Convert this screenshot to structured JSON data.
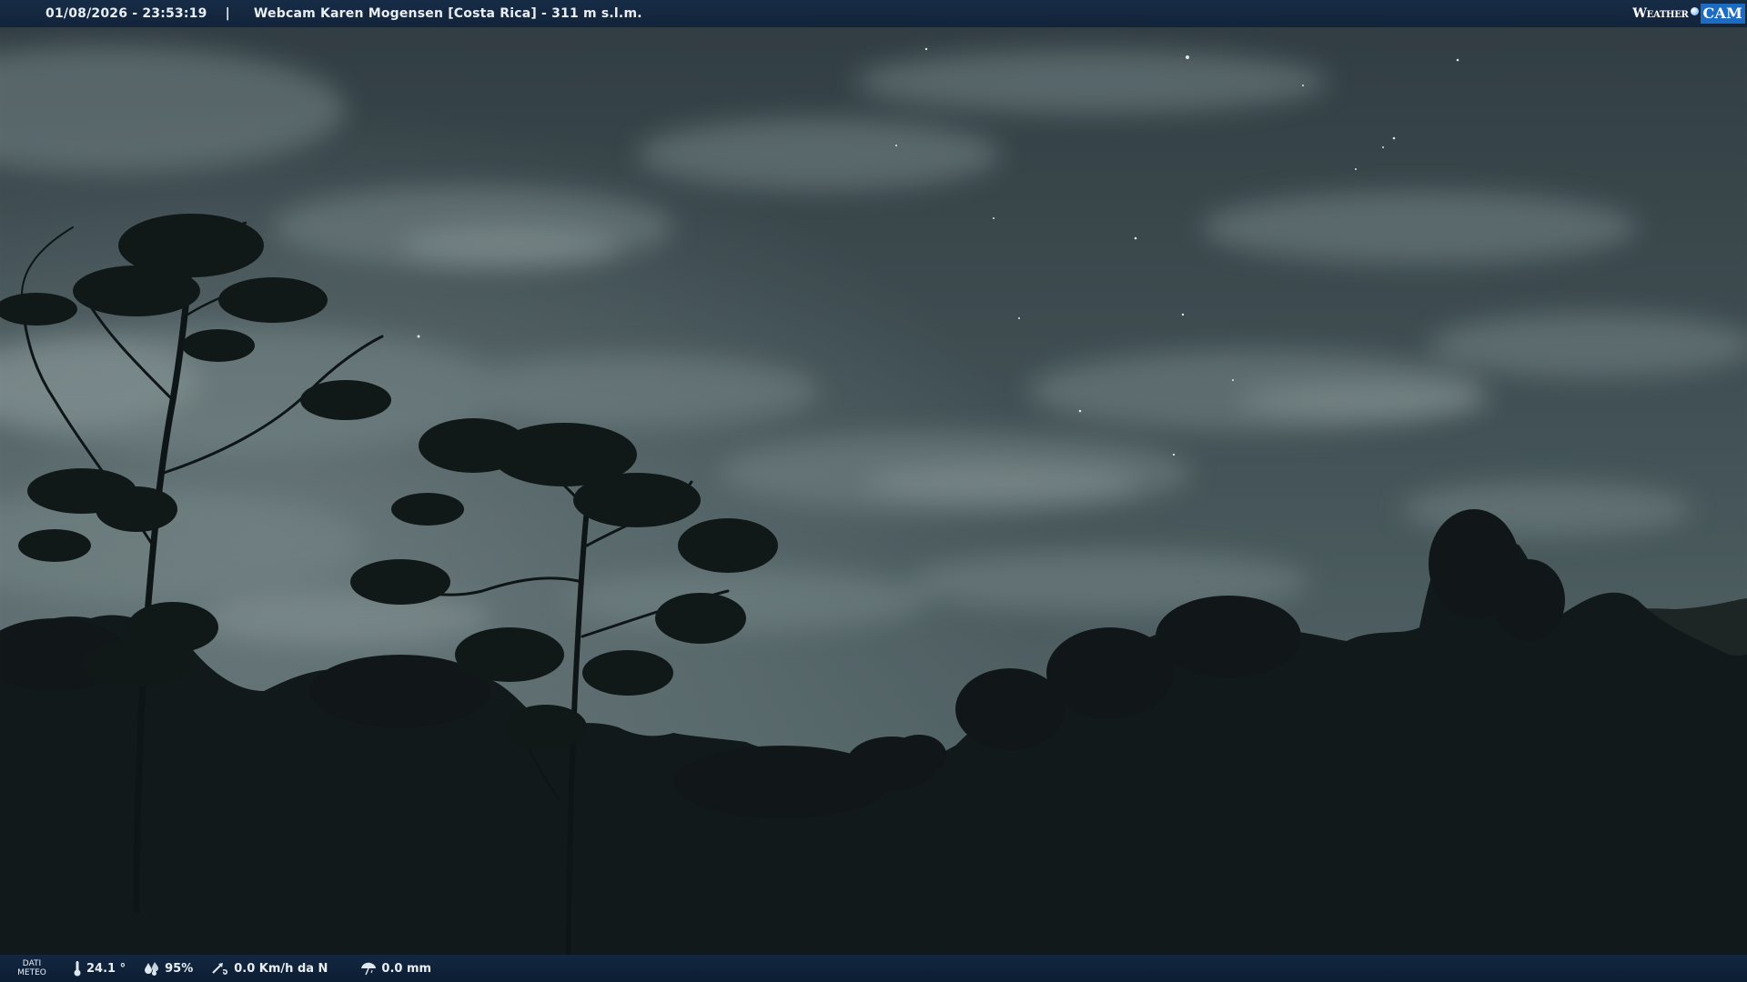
{
  "header": {
    "datetime": "01/08/2026 - 23:53:19",
    "separator": "|",
    "title": "Webcam Karen Mogensen [Costa Rica] - 311 m s.l.m.",
    "logo_weather": "Weather",
    "logo_cam": "CAM"
  },
  "footer": {
    "label_line1": "DATI",
    "label_line2": "METEO",
    "temperature": "24.1 °",
    "humidity": "95%",
    "wind": "0.0 Km/h da N",
    "rain": "0.0 mm"
  },
  "icons": {
    "temperature": "thermometer-icon",
    "humidity": "humidity-drops-icon",
    "wind": "wind-icon",
    "rain": "rain-umbrella-icon"
  },
  "colors": {
    "bar_background": "#13294a",
    "logo_accent": "#1d6cc2",
    "sky_top": "#3a4a50",
    "sky_bottom": "#54656a",
    "forest": "#141b1c"
  }
}
